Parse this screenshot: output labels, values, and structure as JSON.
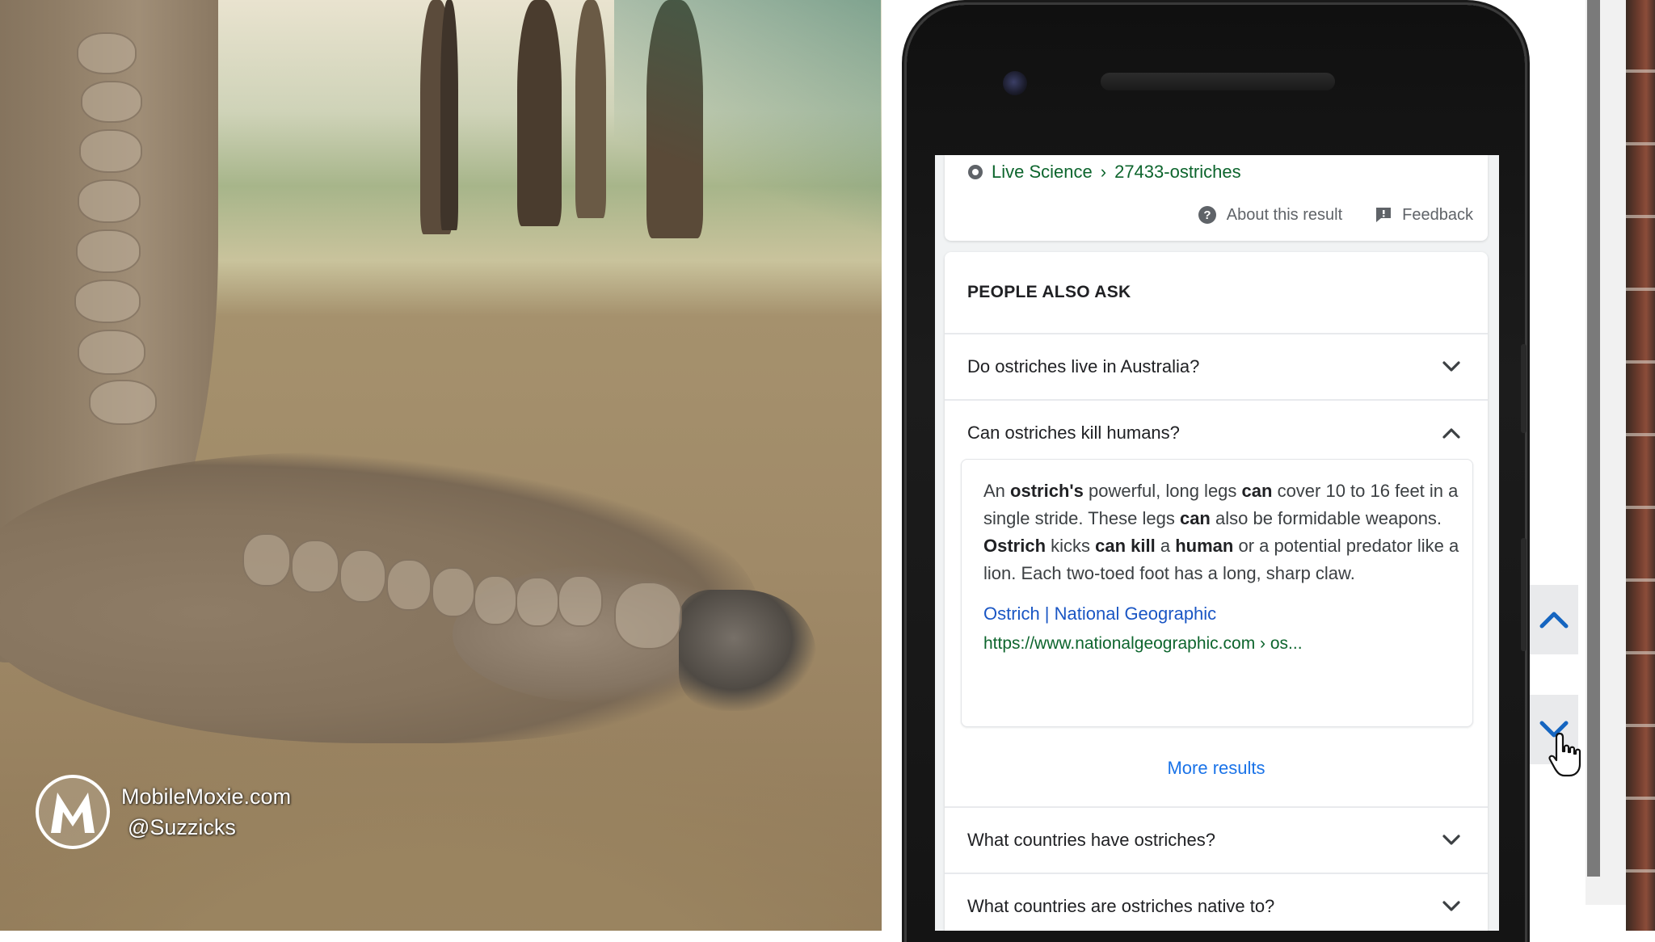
{
  "watermark": {
    "site": "MobileMoxie.com",
    "handle": "@Suzzicks",
    "logo_icon": "m-circle-logo"
  },
  "search_result": {
    "source_site": "Live Science",
    "source_path": "27433-ostriches",
    "separator": "›",
    "about_label": "About this result",
    "feedback_label": "Feedback"
  },
  "people_also_ask": {
    "heading": "PEOPLE ALSO ASK",
    "questions": [
      {
        "text": "Do ostriches live in Australia?",
        "expanded": false
      },
      {
        "text": "Can ostriches kill humans?",
        "expanded": true
      },
      {
        "text": "What countries have ostriches?",
        "expanded": false
      },
      {
        "text": "What countries are ostriches native to?",
        "expanded": false
      }
    ],
    "answer": {
      "segments": [
        {
          "t": "An ",
          "b": false
        },
        {
          "t": "ostrich's",
          "b": true
        },
        {
          "t": " powerful, long legs ",
          "b": false
        },
        {
          "t": "can",
          "b": true
        },
        {
          "t": " cover 10 to 16 feet in a single stride. These legs ",
          "b": false
        },
        {
          "t": "can",
          "b": true
        },
        {
          "t": " also be formidable weapons. ",
          "b": false
        },
        {
          "t": "Ostrich",
          "b": true
        },
        {
          "t": " kicks ",
          "b": false
        },
        {
          "t": "can kill",
          "b": true
        },
        {
          "t": " a ",
          "b": false
        },
        {
          "t": "human",
          "b": true
        },
        {
          "t": " or a potential predator like a lion. Each two-toed foot has a long, sharp claw.",
          "b": false
        }
      ],
      "source_title": "Ostrich | National Geographic",
      "source_url": "https://www.nationalgeographic.com › os..."
    },
    "more_results": "More results"
  },
  "controls": {
    "scroll_up_icon": "chevron-up-icon",
    "scroll_down_icon": "chevron-down-icon",
    "cursor_icon": "hand-pointer-icon"
  },
  "colors": {
    "link_blue": "#1a73e8",
    "source_title_blue": "#1a56c4",
    "url_green": "#0d652d",
    "text_dark": "#202124",
    "chevron_blue": "#1565c0"
  }
}
